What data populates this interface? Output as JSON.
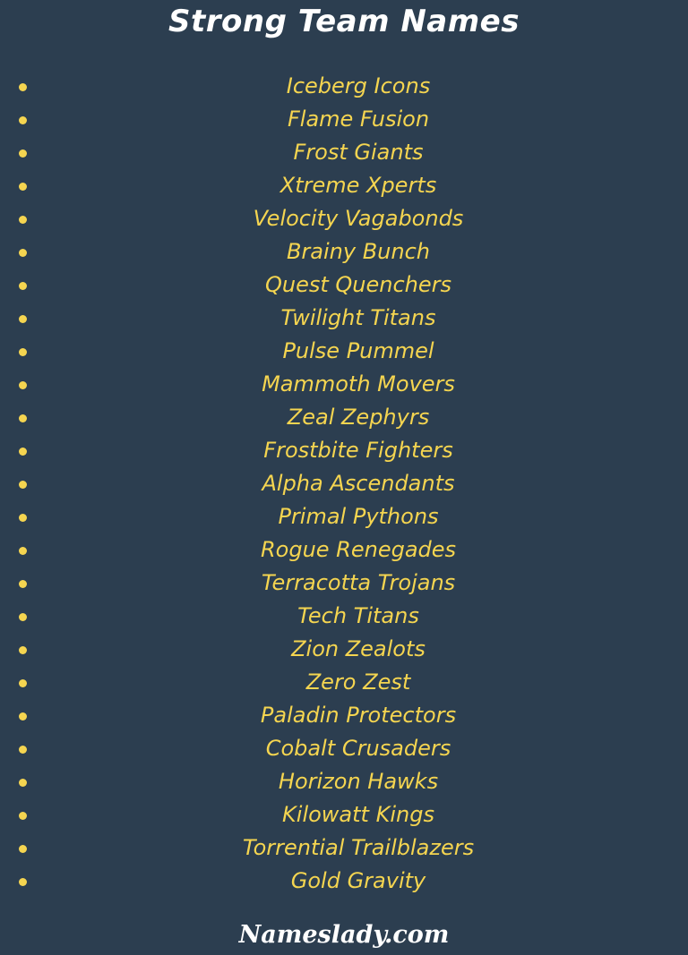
{
  "header": {
    "title": "Strong Team Names"
  },
  "colors": {
    "background": "#2c3e50",
    "accent": "#f5d550",
    "title": "#ffffff"
  },
  "list": {
    "items": [
      "Iceberg Icons",
      "Flame Fusion",
      "Frost Giants",
      "Xtreme Xperts",
      "Velocity Vagabonds",
      "Brainy Bunch",
      "Quest Quenchers",
      "Twilight Titans",
      "Pulse Pummel",
      "Mammoth Movers",
      "Zeal Zephyrs",
      "Frostbite Fighters",
      "Alpha Ascendants",
      "Primal Pythons",
      "Rogue Renegades",
      "Terracotta Trojans",
      "Tech Titans",
      "Zion Zealots",
      "Zero Zest",
      "Paladin Protectors",
      "Cobalt Crusaders",
      "Horizon Hawks",
      "Kilowatt Kings",
      "Torrential Trailblazers",
      "Gold Gravity"
    ]
  },
  "footer": {
    "brand": "Nameslady.com"
  }
}
